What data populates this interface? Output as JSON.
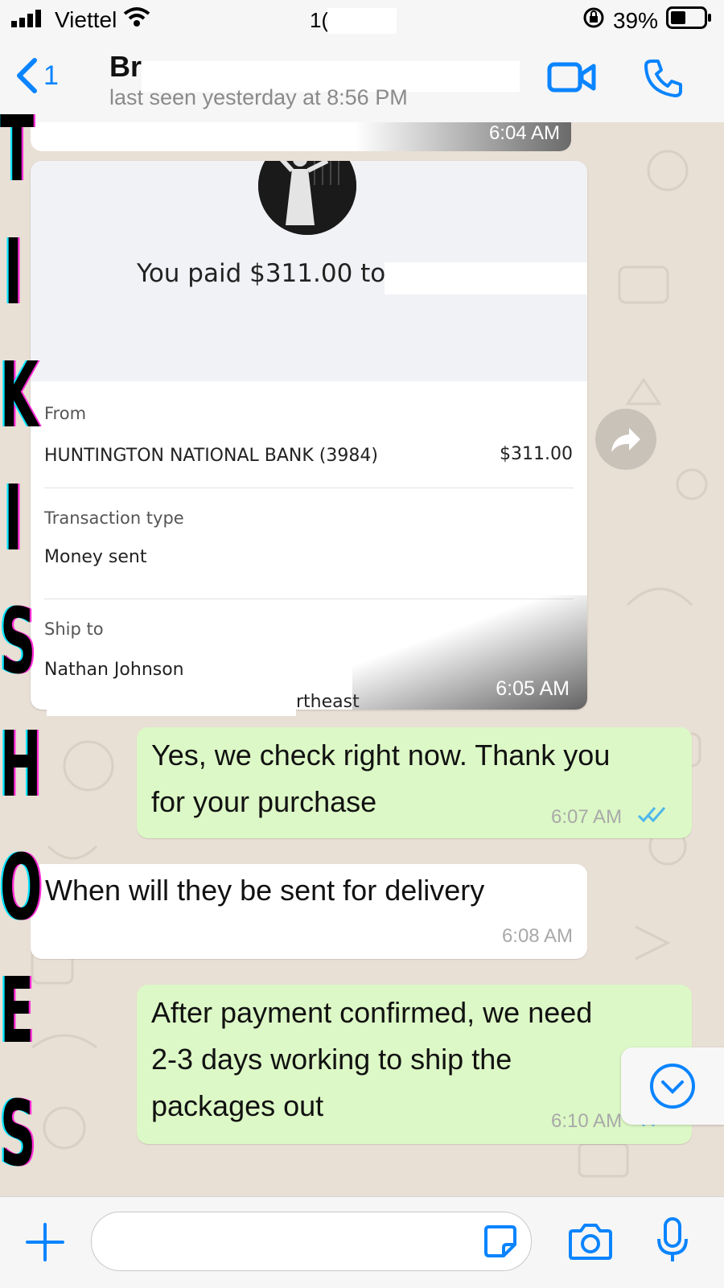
{
  "status_bar": {
    "carrier": "Viettel",
    "time": "1(  ...  M",
    "battery": "39%"
  },
  "header": {
    "back_count": "1",
    "contact_name": "Br...",
    "last_seen": "last seen yesterday at 8:56 PM"
  },
  "payment_card": {
    "top_time": "6:04 AM",
    "paid_text": "You paid $311.00 to",
    "from_label": "From",
    "from_value": "HUNTINGTON NATIONAL BANK (3984)",
    "amount": "$311.00",
    "txn_label": "Transaction type",
    "txn_value": "Money sent",
    "ship_label": "Ship to",
    "ship_name": "Nathan Johnson",
    "ship_address_fragment": "rtheast",
    "time": "6:05 AM"
  },
  "messages": [
    {
      "direction": "out",
      "text_lines": [
        "Yes, we check right now. Thank you",
        "for your purchase"
      ],
      "time": "6:07 AM"
    },
    {
      "direction": "in",
      "text_lines": [
        "When will they be sent for delivery"
      ],
      "time": "6:08 AM"
    },
    {
      "direction": "out",
      "text_lines": [
        "After payment confirmed, we need",
        "2-3 days working to ship the",
        "packages out"
      ],
      "time": "6:10 AM"
    }
  ],
  "watermark": {
    "text": "TIKISHOES"
  },
  "colors": {
    "outgoing_bubble": "#dcf8c6",
    "accent": "#0a84ff",
    "chat_bg": "#e8dfd5"
  },
  "icons": [
    "signal-icon",
    "wifi-icon",
    "lock-rotation-icon",
    "battery-icon",
    "back-chevron-icon",
    "video-call-icon",
    "phone-icon",
    "forward-icon",
    "double-check-icon",
    "scroll-down-icon",
    "plus-icon",
    "sticker-icon",
    "camera-icon",
    "microphone-icon"
  ]
}
